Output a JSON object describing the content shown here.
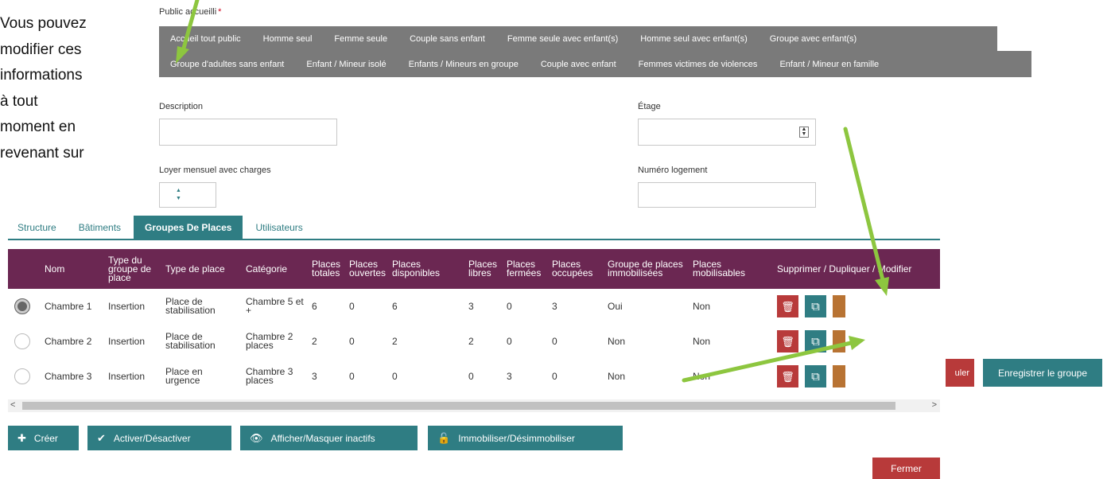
{
  "side_text": [
    "Vous pouvez",
    "modifier ces",
    "informations",
    "à tout",
    "moment en",
    "revenant sur"
  ],
  "public_accueilli": {
    "label": "Public accueilli",
    "required": "*",
    "options_row1": [
      "Accueil tout public",
      "Homme seul",
      "Femme seule",
      "Couple sans enfant",
      "Femme seule avec enfant(s)",
      "Homme seul avec enfant(s)",
      "Groupe avec enfant(s)"
    ],
    "options_row2": [
      "Groupe d'adultes sans enfant",
      "Enfant / Mineur isolé",
      "Enfants / Mineurs en groupe",
      "Couple avec enfant",
      "Femmes victimes de violences",
      "Enfant / Mineur en famille"
    ]
  },
  "form": {
    "description_label": "Description",
    "etage_label": "Étage",
    "loyer_label": "Loyer mensuel avec charges",
    "numero_label": "Numéro logement"
  },
  "tabs": [
    "Structure",
    "Bâtiments",
    "Groupes De Places",
    "Utilisateurs"
  ],
  "table": {
    "columns": [
      "Nom",
      "Type du groupe de place",
      "Type de place",
      "Catégorie",
      "Places totales",
      "Places ouvertes",
      "Places disponibles",
      "Places libres",
      "Places fermées",
      "Places occupées",
      "Groupe de places immobilisées",
      "Places mobilisables",
      "Supprimer / Dupliquer / Modifier"
    ],
    "rows": [
      {
        "nom": "Chambre 1",
        "type_groupe": "Insertion",
        "type_place": "Place de stabilisation",
        "categorie": "Chambre 5 et +",
        "totales": "6",
        "ouvertes": "0",
        "disponibles": "6",
        "libres": "3",
        "fermees": "0",
        "occupees": "3",
        "immobilisees": "Oui",
        "mobilisables": "Non"
      },
      {
        "nom": "Chambre 2",
        "type_groupe": "Insertion",
        "type_place": "Place de stabilisation",
        "categorie": "Chambre 2 places",
        "totales": "2",
        "ouvertes": "0",
        "disponibles": "2",
        "libres": "2",
        "fermees": "0",
        "occupees": "0",
        "immobilisees": "Non",
        "mobilisables": "Non"
      },
      {
        "nom": "Chambre 3",
        "type_groupe": "Insertion",
        "type_place": "Place en urgence",
        "categorie": "Chambre 3 places",
        "totales": "3",
        "ouvertes": "0",
        "disponibles": "0",
        "libres": "0",
        "fermees": "3",
        "occupees": "0",
        "immobilisees": "Non",
        "mobilisables": "Non"
      }
    ]
  },
  "buttons": {
    "creer": "Créer",
    "activer": "Activer/Désactiver",
    "afficher": "Afficher/Masquer inactifs",
    "immobiliser": "Immobiliser/Désimmobiliser",
    "fermer": "Fermer",
    "annuler": "uler",
    "enregistrer": "Enregistrer le groupe"
  },
  "icons": {
    "delete": "trash-icon",
    "duplicate": "copy-icon",
    "creer": "plus-icon",
    "activer": "check-icon",
    "afficher": "eye-icon",
    "immobiliser": "unlock-icon"
  },
  "colors": {
    "teal": "#2f7d83",
    "header_purple": "#6b2752",
    "chip_gray": "#7a7a7a",
    "danger": "#b83a3a",
    "modify": "#b87333",
    "arrow": "#8dc63f"
  }
}
